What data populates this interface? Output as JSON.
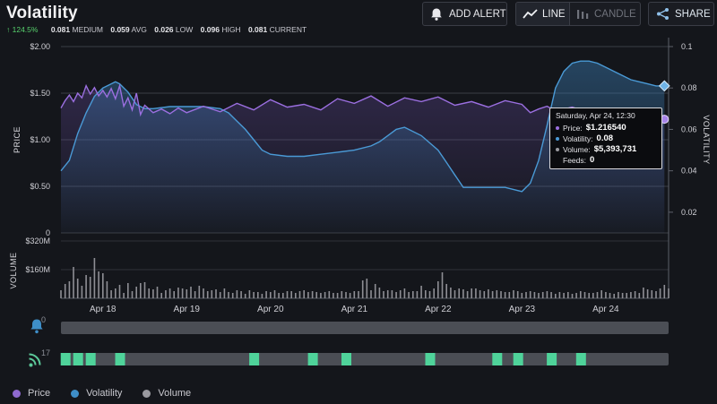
{
  "header": {
    "title": "Volatility",
    "stats": {
      "change": "124.5%",
      "medium_value": "0.081",
      "medium_label": "MEDIUM",
      "avg_value": "0.059",
      "avg_label": "AVG",
      "low_value": "0.026",
      "low_label": "LOW",
      "high_value": "0.096",
      "high_label": "HIGH",
      "current_value": "0.081",
      "current_label": "CURRENT"
    }
  },
  "toolbar": {
    "add_alert_label": "ADD ALERT",
    "line_label": "LINE",
    "candle_label": "CANDLE",
    "share_label": "SHARE",
    "active_view": "line"
  },
  "tooltip": {
    "date": "Saturday, Apr 24, 12:30",
    "price_label": "Price:",
    "price_value": "$1.216540",
    "volatility_label": "Volatility:",
    "volatility_value": "0.08",
    "volume_label": "Volume:",
    "volume_value": "$5,393,731",
    "feeds_label": "Feeds:",
    "feeds_value": "0"
  },
  "lanes": {
    "alerts_count": "0",
    "feeds_count": "17",
    "feed_marker_days": [
      17.55,
      17.7,
      17.85,
      18.2,
      19.8,
      20.5,
      20.9,
      21.9,
      22.7,
      22.95,
      23.35,
      23.7
    ]
  },
  "legend": [
    {
      "label": "Price",
      "color": "#8f6ad0"
    },
    {
      "label": "Volatility",
      "color": "#3e8ec8"
    },
    {
      "label": "Volume",
      "color": "#9a9aa0"
    }
  ],
  "colors": {
    "price": "#9b6fe0",
    "volatility": "#4a9ad6",
    "volume": "#8e8e94",
    "feed_marker": "#4fd39a",
    "change_up": "#57d16d"
  },
  "chart_data": {
    "type": "line",
    "x_unit": "day of April",
    "x_ticks": [
      18,
      19,
      20,
      21,
      22,
      23,
      24
    ],
    "x_tick_labels": [
      "Apr 18",
      "Apr 19",
      "Apr 20",
      "Apr 21",
      "Apr 22",
      "Apr 23",
      "Apr 24"
    ],
    "xlim": [
      17.5,
      24.75
    ],
    "price_axis": {
      "label": "PRICE",
      "ylim": [
        0,
        2.0
      ],
      "ticks": [
        0,
        0.5,
        1.0,
        1.5,
        2.0
      ],
      "tick_labels": [
        "0",
        "$0.50",
        "$1.00",
        "$1.50",
        "$2.00"
      ]
    },
    "volatility_axis": {
      "label": "VOLATILITY",
      "ylim": [
        0.01,
        0.1
      ],
      "ticks": [
        0.02,
        0.04,
        0.06,
        0.08,
        0.1
      ],
      "tick_labels": [
        "0.02",
        "0.04",
        "0.06",
        "0.08",
        "0.1"
      ]
    },
    "volume_axis": {
      "label": "VOLUME",
      "ylim": [
        0,
        320
      ],
      "ticks": [
        160,
        320
      ],
      "tick_labels": [
        "$160M",
        "$320M"
      ]
    },
    "price_series": {
      "name": "Price",
      "x": [
        17.5,
        17.55,
        17.6,
        17.65,
        17.7,
        17.75,
        17.8,
        17.85,
        17.9,
        17.95,
        18.0,
        18.05,
        18.1,
        18.15,
        18.2,
        18.25,
        18.3,
        18.35,
        18.4,
        18.45,
        18.5,
        18.6,
        18.7,
        18.8,
        18.9,
        19.0,
        19.2,
        19.4,
        19.6,
        19.8,
        20.0,
        20.2,
        20.4,
        20.6,
        20.8,
        21.0,
        21.2,
        21.4,
        21.6,
        21.8,
        22.0,
        22.2,
        22.4,
        22.6,
        22.8,
        23.0,
        23.1,
        23.2,
        23.3,
        23.4,
        23.6,
        23.8,
        24.0,
        24.2,
        24.4,
        24.5,
        24.6,
        24.7
      ],
      "y": [
        1.34,
        1.42,
        1.48,
        1.41,
        1.5,
        1.45,
        1.58,
        1.49,
        1.56,
        1.47,
        1.53,
        1.46,
        1.55,
        1.44,
        1.58,
        1.36,
        1.45,
        1.32,
        1.5,
        1.27,
        1.37,
        1.29,
        1.33,
        1.28,
        1.34,
        1.29,
        1.36,
        1.3,
        1.39,
        1.32,
        1.43,
        1.35,
        1.38,
        1.32,
        1.44,
        1.39,
        1.47,
        1.36,
        1.45,
        1.41,
        1.46,
        1.37,
        1.41,
        1.35,
        1.42,
        1.38,
        1.29,
        1.33,
        1.36,
        1.31,
        1.35,
        1.29,
        1.33,
        1.27,
        1.3,
        1.25,
        1.24,
        1.22
      ]
    },
    "volatility_series": {
      "name": "Volatility",
      "x": [
        17.5,
        17.6,
        17.7,
        17.8,
        17.9,
        18.0,
        18.1,
        18.15,
        18.2,
        18.3,
        18.4,
        18.5,
        18.6,
        18.8,
        19.0,
        19.2,
        19.4,
        19.5,
        19.6,
        19.7,
        19.8,
        19.9,
        20.0,
        20.2,
        20.4,
        20.6,
        20.8,
        21.0,
        21.2,
        21.3,
        21.4,
        21.5,
        21.6,
        21.8,
        22.0,
        22.1,
        22.2,
        22.3,
        22.4,
        22.6,
        22.8,
        23.0,
        23.1,
        23.2,
        23.3,
        23.4,
        23.5,
        23.6,
        23.7,
        23.8,
        23.9,
        24.0,
        24.1,
        24.2,
        24.3,
        24.4,
        24.5,
        24.6,
        24.7
      ],
      "y": [
        0.04,
        0.045,
        0.058,
        0.068,
        0.076,
        0.08,
        0.082,
        0.083,
        0.082,
        0.078,
        0.072,
        0.07,
        0.07,
        0.071,
        0.071,
        0.071,
        0.07,
        0.068,
        0.064,
        0.06,
        0.055,
        0.05,
        0.048,
        0.047,
        0.047,
        0.048,
        0.049,
        0.05,
        0.052,
        0.054,
        0.057,
        0.06,
        0.061,
        0.057,
        0.05,
        0.044,
        0.038,
        0.032,
        0.032,
        0.032,
        0.032,
        0.03,
        0.034,
        0.045,
        0.062,
        0.08,
        0.088,
        0.092,
        0.093,
        0.093,
        0.092,
        0.09,
        0.088,
        0.086,
        0.084,
        0.083,
        0.082,
        0.081,
        0.081
      ]
    },
    "volume_series": {
      "name": "Volume",
      "x_start": 17.5,
      "x_step": 0.05,
      "values": [
        45,
        80,
        95,
        175,
        110,
        70,
        130,
        120,
        225,
        150,
        140,
        95,
        45,
        55,
        75,
        30,
        85,
        40,
        65,
        85,
        90,
        55,
        50,
        65,
        30,
        45,
        55,
        40,
        60,
        55,
        50,
        65,
        40,
        70,
        55,
        40,
        45,
        50,
        35,
        55,
        35,
        30,
        45,
        40,
        25,
        45,
        35,
        35,
        25,
        40,
        35,
        45,
        30,
        30,
        40,
        40,
        30,
        40,
        45,
        35,
        40,
        35,
        30,
        35,
        40,
        30,
        30,
        40,
        35,
        30,
        40,
        40,
        100,
        110,
        45,
        80,
        60,
        40,
        45,
        45,
        35,
        45,
        55,
        35,
        40,
        40,
        70,
        45,
        40,
        55,
        95,
        145,
        80,
        60,
        45,
        55,
        50,
        40,
        55,
        55,
        45,
        40,
        50,
        40,
        45,
        40,
        35,
        35,
        45,
        40,
        30,
        35,
        40,
        35,
        30,
        35,
        40,
        35,
        25,
        35,
        30,
        35,
        25,
        30,
        40,
        35,
        30,
        30,
        35,
        45,
        35,
        30,
        25,
        35,
        30,
        30,
        35,
        40,
        30,
        60,
        50,
        45,
        40,
        55,
        75,
        55,
        45,
        40,
        45,
        30,
        35,
        40,
        30,
        45,
        40,
        30,
        25,
        30,
        40,
        35,
        30,
        30,
        40,
        35,
        30,
        25,
        30,
        30,
        45,
        35,
        20,
        40,
        30,
        25,
        20,
        25,
        25,
        60,
        30
      ]
    },
    "cursor": {
      "x": 24.7,
      "price": 1.22,
      "volatility": 0.081
    }
  }
}
